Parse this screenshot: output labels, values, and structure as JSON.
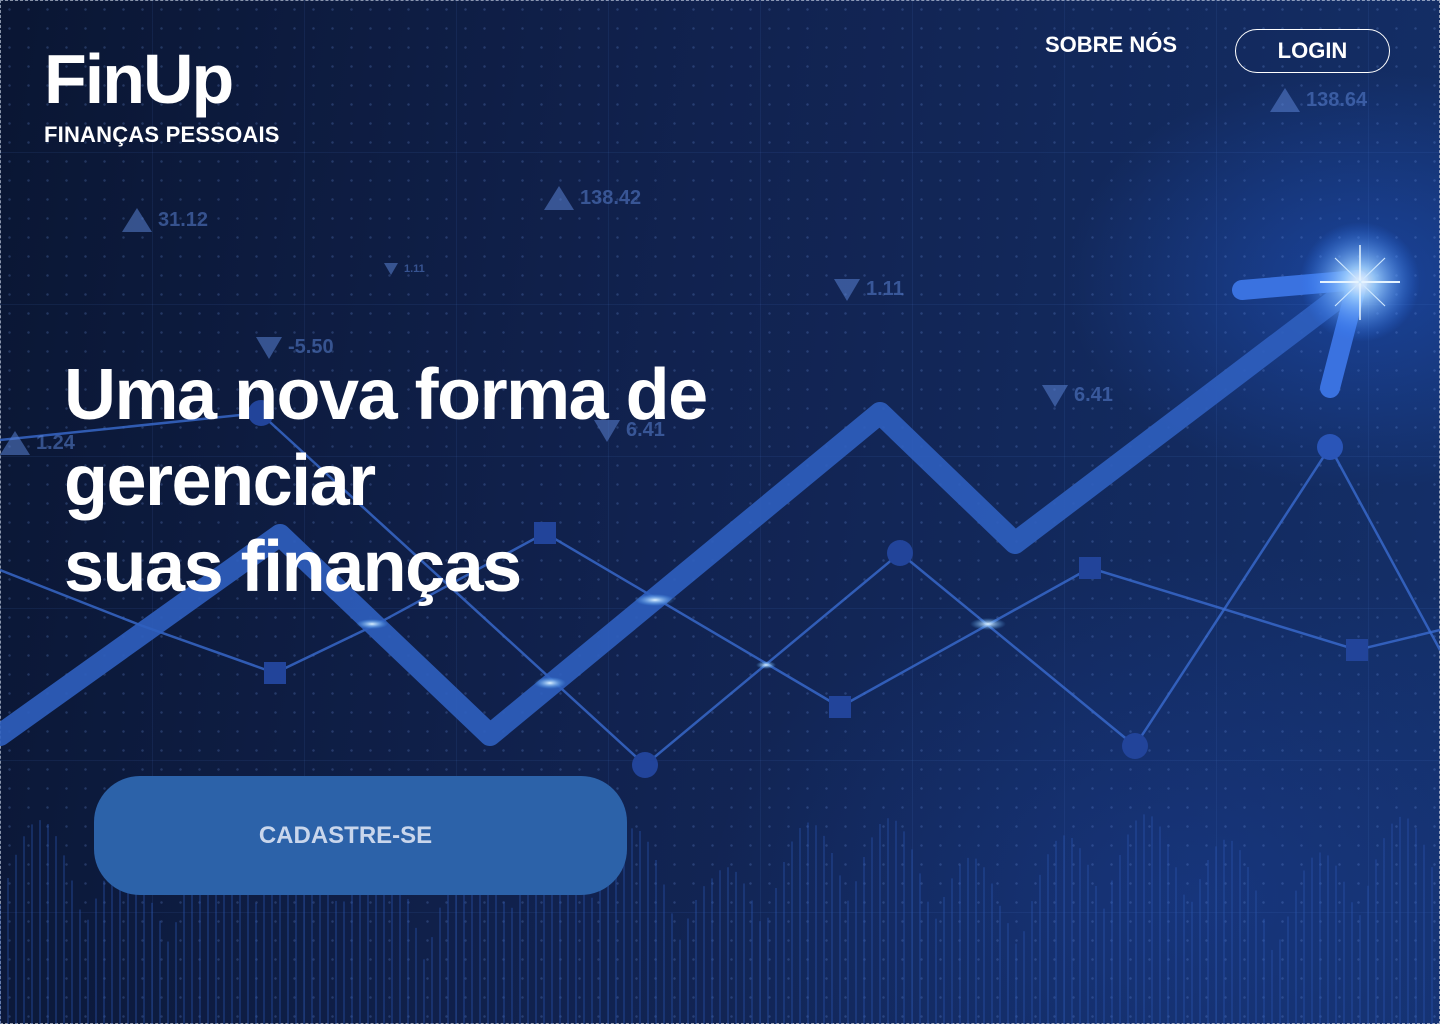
{
  "brand": {
    "name": "FinUp",
    "tagline": "FINANÇAS PESSOAIS"
  },
  "nav": {
    "about_label": "SOBRE NÓS",
    "login_label": "LOGIN"
  },
  "hero": {
    "headline_lines": [
      "Uma nova forma de",
      "gerenciar",
      "suas finanças"
    ],
    "cta_label": "CADASTRE-SE"
  },
  "background_tickers": [
    {
      "direction": "up",
      "value": "138.64"
    },
    {
      "direction": "up",
      "value": "138.42"
    },
    {
      "direction": "up",
      "value": "31.12"
    },
    {
      "direction": "down",
      "value": "1.11"
    },
    {
      "direction": "down",
      "value": "1.11"
    },
    {
      "direction": "down",
      "value": "-5.50"
    },
    {
      "direction": "down",
      "value": "6.41"
    },
    {
      "direction": "down",
      "value": "6.41"
    },
    {
      "direction": "up",
      "value": "1.24"
    }
  ],
  "colors": {
    "background": "#0d1a3d",
    "accent": "#2c62a9",
    "arrow": "#2f5fbf",
    "text": "#ffffff"
  }
}
